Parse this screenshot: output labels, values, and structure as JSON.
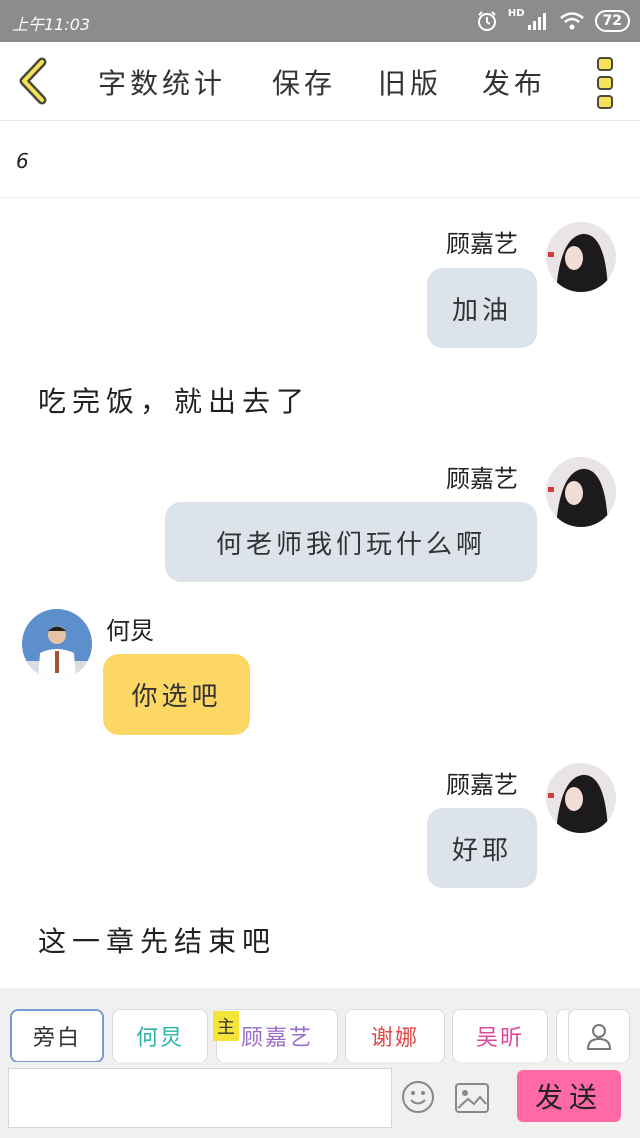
{
  "status_bar": {
    "time": "上午11:03",
    "network": "HD",
    "battery": "72"
  },
  "toolbar": {
    "word_count": "字数统计",
    "save": "保存",
    "old_version": "旧版",
    "publish": "发布"
  },
  "chapter": {
    "number": "6"
  },
  "messages": [
    {
      "side": "right",
      "name": "顾嘉艺",
      "text": "加油"
    },
    {
      "side": "narration",
      "text": "吃完饭，就出去了"
    },
    {
      "side": "right",
      "name": "顾嘉艺",
      "text": "何老师我们玩什么啊"
    },
    {
      "side": "left",
      "name": "何炅",
      "text": "你选吧"
    },
    {
      "side": "right",
      "name": "顾嘉艺",
      "text": "好耶"
    },
    {
      "side": "narration",
      "text": "这一章先结束吧"
    }
  ],
  "characters": [
    {
      "label": "旁白",
      "color": "#333333",
      "selected": true
    },
    {
      "label": "何炅",
      "color": "#2bb5a8",
      "selected": false
    },
    {
      "label": "顾嘉艺",
      "color": "#9a6cc9",
      "selected": false,
      "badge": "主"
    },
    {
      "label": "谢娜",
      "color": "#e04848",
      "selected": false
    },
    {
      "label": "吴昕",
      "color": "#e0479a",
      "selected": false
    }
  ],
  "input": {
    "value": "",
    "placeholder": "",
    "send_label": "发送"
  },
  "icons": [
    "back-chevron-icon",
    "more-dots-icon",
    "alarm-icon",
    "signal-icon",
    "wifi-icon",
    "emoji-icon",
    "image-icon",
    "person-icon"
  ]
}
